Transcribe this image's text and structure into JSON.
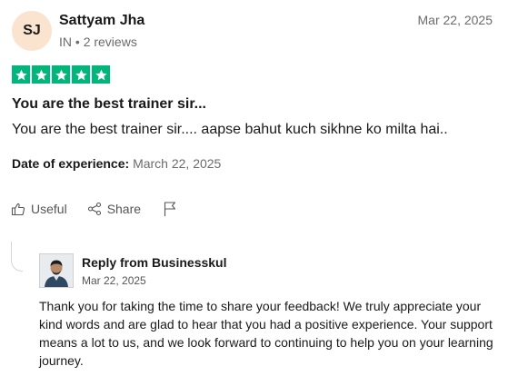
{
  "reviewer": {
    "initials": "SJ",
    "name": "Sattyam Jha",
    "country": "IN",
    "separator": "•",
    "reviews": "2 reviews"
  },
  "review": {
    "date": "Mar 22, 2025",
    "rating": 5,
    "rating_color": "#00b67a",
    "title": "You are the best trainer sir...",
    "text": "You are the best trainer sir.... aapse bahut kuch sikhne ko milta hai..",
    "experience_label": "Date of experience:",
    "experience_date": "March 22, 2025"
  },
  "actions": {
    "useful_label": "Useful",
    "share_label": "Share",
    "useful_icon": "thumbs-up-icon",
    "share_icon": "share-icon",
    "flag_icon": "flag-icon"
  },
  "reply": {
    "from_label": "Reply from Businesskul",
    "date": "Mar 22, 2025",
    "text": "Thank you for taking the time to share your feedback! We truly appreciate your kind words and are glad to hear that you had a positive experience. Your support means a lot to us, and we look forward to continuing to help you on your learning journey."
  }
}
